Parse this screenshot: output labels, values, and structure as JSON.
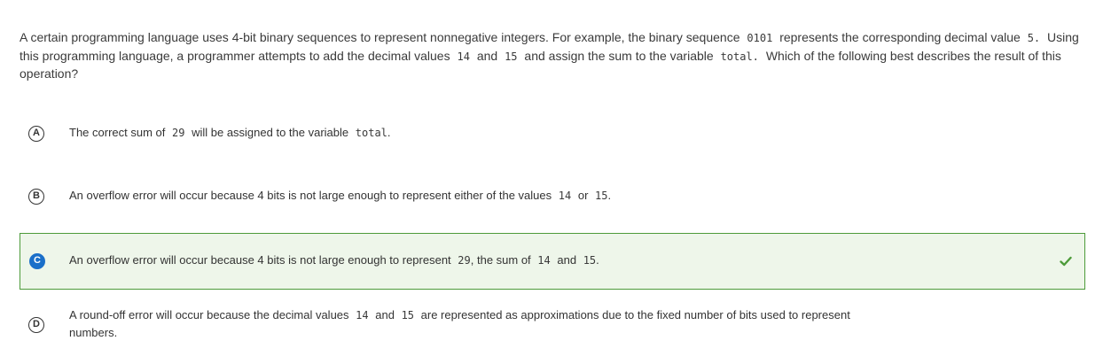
{
  "question": {
    "part1": "A certain programming language uses 4-bit binary sequences to represent nonnegative integers. For example, the binary sequence",
    "code1": "0101",
    "part2": "represents the corresponding decimal value",
    "code2": "5.",
    "part3": "Using this programming language, a programmer attempts to add the decimal values",
    "code3": "14",
    "part4": "and",
    "code4": "15",
    "part5": "and assign the sum to the variable",
    "code5": "total.",
    "part6": "Which of the following best describes the result of this operation?"
  },
  "choices": [
    {
      "letter": "A",
      "t1": "The correct sum of",
      "c1": "29",
      "t2": "will be assigned to the variable",
      "c2": "total",
      "t3": "."
    },
    {
      "letter": "B",
      "t1": "An overflow error will occur because 4 bits is not large enough to represent either of the values",
      "c1": "14",
      "t2": "or",
      "c2": "15",
      "t3": "."
    },
    {
      "letter": "C",
      "t1": "An overflow error will occur because 4 bits is not large enough to represent",
      "c1": "29",
      "t2": ", the sum of",
      "c2": "14",
      "t3": "and",
      "c3": "15",
      "t4": ".",
      "selected": true,
      "correct": true
    },
    {
      "letter": "D",
      "t1": "A round-off error will occur because the decimal values",
      "c1": "14",
      "t2": "and",
      "c2": "15",
      "t3": "are represented as approximations due to the fixed number of bits used to represent",
      "t4": "numbers."
    }
  ],
  "colors": {
    "selected_bg": "#eef6ea",
    "selected_border": "#4d9b3a",
    "selected_letter_bg": "#1a6fc9",
    "check": "#4d9b3a"
  },
  "icons": {
    "correct": "check-icon"
  }
}
